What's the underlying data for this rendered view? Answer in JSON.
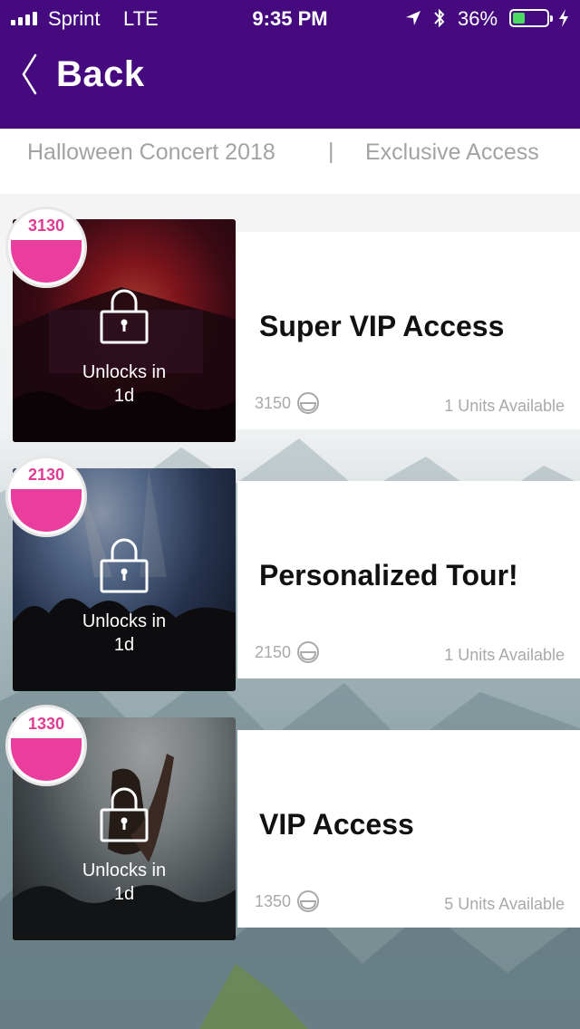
{
  "status_bar": {
    "carrier": "Sprint",
    "network": "LTE",
    "time": "9:35 PM",
    "battery": "36%",
    "battery_level": 0.36,
    "icons": [
      "signal-bars-icon",
      "location-arrow-icon",
      "bluetooth-icon",
      "battery-icon",
      "charging-bolt-icon"
    ]
  },
  "header": {
    "back_label": "Back",
    "background_color": "#440a7e"
  },
  "breadcrumb": {
    "event": "Halloween Concert 2018",
    "separator": "|",
    "section": "Exclusive Access"
  },
  "rewards": [
    {
      "badge": "3130",
      "title": "Super VIP Access",
      "cost": "3150",
      "units": "1 Units Available",
      "unlock_line1": "Unlocks in",
      "unlock_line2": "1d"
    },
    {
      "badge": "2130",
      "title": "Personalized Tour!",
      "cost": "2150",
      "units": "1 Units Available",
      "unlock_line1": "Unlocks in",
      "unlock_line2": "1d"
    },
    {
      "badge": "1330",
      "title": "VIP Access",
      "cost": "1350",
      "units": "5 Units Available",
      "unlock_line1": "Unlocks in",
      "unlock_line2": "1d"
    }
  ],
  "colors": {
    "accent_pink": "#ea3e9e",
    "badge_text": "#e03c91",
    "muted_text": "#a9a9a9"
  }
}
